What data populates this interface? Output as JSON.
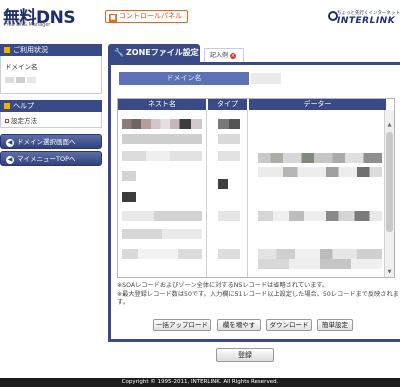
{
  "header": {
    "logo_text": "無料DNS",
    "logo_sub": "Free DNS Manager",
    "control_panel_label": "コントロールパネル",
    "brand_tagline": "ちょっと先行くインターネット",
    "brand_name": "INTERLINK"
  },
  "sidebar": {
    "usage_title": "ご利用状況",
    "domain_label": "ドメイン名",
    "help_title": "ヘルプ",
    "help_link": "設定方法",
    "nav_buttons": [
      {
        "label": "ドメイン選択画面へ"
      },
      {
        "label": "マイメニューTOPへ"
      }
    ]
  },
  "tabs": {
    "active_label": "ZONEファイル設定",
    "inactive_label": "記入例"
  },
  "panel": {
    "domain_field_label": "ドメイン名",
    "columns": [
      "ネスト名",
      "タイプ",
      "データー"
    ],
    "notes": [
      "※SOAレコードおよびゾーン全体に対するNSレコードは省略されています。",
      "※最大登録レコード数は50です。入力欄に51レコード以上設定した場合、50レコードまで反映されます。"
    ],
    "buttons": [
      {
        "label": "一括アップロード"
      },
      {
        "label": "欄を増やす"
      },
      {
        "label": "ダウンロード"
      },
      {
        "label": "簡単設定"
      }
    ],
    "save_label": "登録"
  },
  "footer": {
    "copyright": "Copyright © 1995-2011, INTERLINK. All Rights Reserved."
  },
  "colors": {
    "navy": "#3a4a86",
    "accent_orange": "#e06a1a",
    "field_blue": "#5c72b4"
  }
}
